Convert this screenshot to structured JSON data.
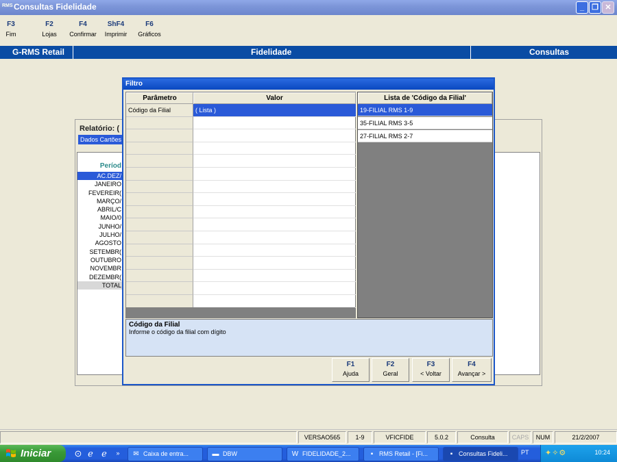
{
  "window": {
    "app_icon": "RMS",
    "title": "Consultas Fidelidade"
  },
  "fkeys": [
    {
      "key": "F3",
      "label": "Fim"
    },
    {
      "key": "F2",
      "label": "Lojas"
    },
    {
      "key": "F4",
      "label": "Confirmar"
    },
    {
      "key": "ShF4",
      "label": "Imprimir"
    },
    {
      "key": "F6",
      "label": "Gráficos"
    }
  ],
  "header": {
    "left": "G-RMS Retail",
    "center": "Fidelidade",
    "right": "Consultas"
  },
  "report": {
    "label": "Relatório: (",
    "sub": "Dados Cartões",
    "period_header": "Períod",
    "periods": [
      "AC.DEZ/",
      "JANEIRO",
      "FEVEREIR(",
      "MARÇO/",
      "ABRIL/C",
      "MAIO/0",
      "JUNHO/",
      "JULHO/",
      "AGOSTO",
      "SETEMBR(",
      "OUTUBRO",
      "NOVEMBR",
      "DEZEMBR(",
      "TOTAL"
    ]
  },
  "dialog": {
    "title": "Filtro",
    "col_param": "Parâmetro",
    "col_value": "Valor",
    "rows": [
      {
        "param": "Código da Filial",
        "value": "( Lista )"
      }
    ],
    "list_header": "Lista de 'Código da Filial'",
    "list_items": [
      "19-FILIAL RMS 1-9",
      "35-FILIAL RMS 3-5",
      "27-FILIAL RMS 2-7"
    ],
    "help_title": "Código da Filial",
    "help_text": "Informe o código da filial com dígito",
    "buttons": [
      {
        "key": "F1",
        "label": "Ajuda"
      },
      {
        "key": "F2",
        "label": "Geral"
      },
      {
        "key": "F3",
        "label": "< Voltar"
      },
      {
        "key": "F4",
        "label": "Avançar >"
      }
    ]
  },
  "statusbar": [
    "VERSAO565",
    "1-9",
    "VFICFIDE",
    "5.0.2",
    "Consulta",
    "CAPS",
    "NUM",
    "21/2/2007"
  ],
  "taskbar": {
    "start": "Iniciar",
    "buttons": [
      "Caixa de entra...",
      "DBW",
      "FIDELIDADE_2...",
      "RMS Retail - [Fi...",
      "Consultas Fideli..."
    ],
    "lang": "PT",
    "clock": "10:24"
  }
}
